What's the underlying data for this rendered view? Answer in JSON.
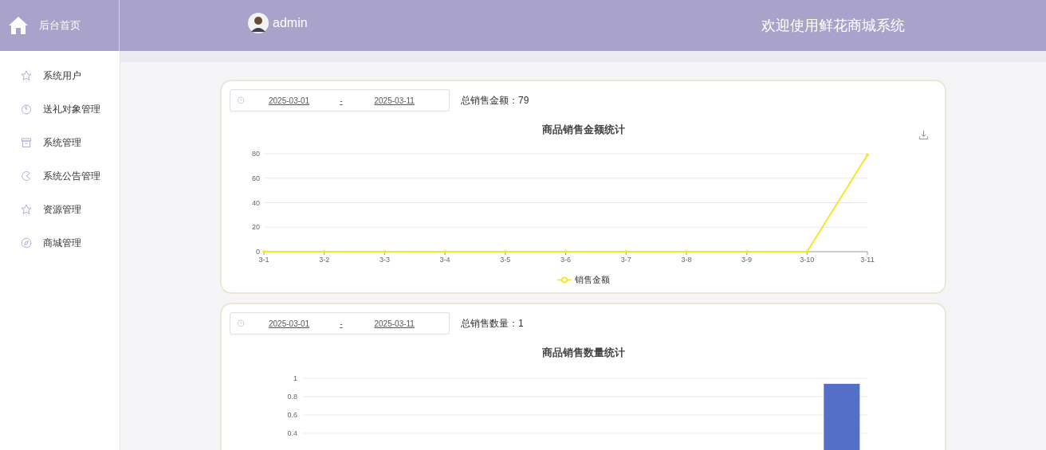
{
  "header": {
    "home_label": "后台首页",
    "user": "admin",
    "welcome": "欢迎使用鲜花商城系统"
  },
  "sidebar": {
    "items": [
      {
        "label": "系统用户"
      },
      {
        "label": "送礼对象管理"
      },
      {
        "label": "系统管理"
      },
      {
        "label": "系统公告管理"
      },
      {
        "label": "资源管理"
      },
      {
        "label": "商城管理"
      }
    ]
  },
  "cards": [
    {
      "date_start": "2025-03-01",
      "separator": "-",
      "date_end": "2025-03-11",
      "total": "总销售金额：79",
      "chart_data": {
        "type": "line",
        "title": "商品销售金额统计",
        "categories": [
          "3-1",
          "3-2",
          "3-3",
          "3-4",
          "3-5",
          "3-6",
          "3-7",
          "3-8",
          "3-9",
          "3-10",
          "3-11"
        ],
        "ylim": [
          0,
          80
        ],
        "grid": true,
        "yticks": [
          0,
          20,
          40,
          60,
          80
        ],
        "series": [
          {
            "name": "销售金额",
            "color": "#f5e62a",
            "values": [
              0,
              0,
              0,
              0,
              0,
              0,
              0,
              0,
              0,
              0,
              79
            ]
          }
        ]
      }
    },
    {
      "date_start": "2025-03-01",
      "separator": "-",
      "date_end": "2025-03-11",
      "total": "总销售数量：1",
      "chart_data": {
        "type": "bar",
        "title": "商品销售数量统计",
        "ylim": [
          0,
          1
        ],
        "grid": true,
        "yticks": [
          0.4,
          0.6,
          0.8,
          {
            "value": 1,
            "label": "1"
          }
        ],
        "series": [
          {
            "color": "#5470c6",
            "values": [
              0,
              0,
              0,
              0,
              0,
              0,
              0,
              0,
              0,
              0,
              0.94
            ]
          }
        ]
      }
    }
  ]
}
